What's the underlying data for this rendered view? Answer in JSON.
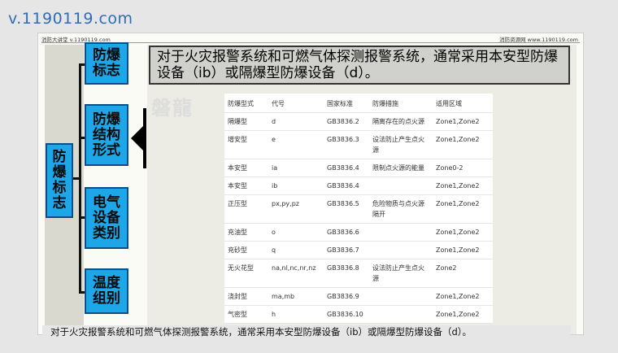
{
  "watermark": "v.1190119.com",
  "slide_header": {
    "left": "消防大讲堂 v.1190119.com",
    "right": "消防资源网 www.1190119.com"
  },
  "root_box": "防爆标志",
  "branches": [
    "防爆标志",
    "防爆结构形式",
    "电气设备类别",
    "温度组别"
  ],
  "callout": "对于火灾报警系统和可燃气体探测报警系统，通常采用本安型防爆设备（ib）或隔爆型防爆设备（d）。",
  "faint_logo": "磐龍",
  "table": {
    "headers": [
      "防爆型式",
      "代号",
      "国家标准",
      "防爆措施",
      "适用区域"
    ],
    "rows": [
      [
        "隔爆型",
        "d",
        "GB3836.2",
        "隔离存在的点火源",
        "Zone1,Zone2"
      ],
      [
        "增安型",
        "e",
        "GB3836.3",
        "设法防止产生点火源",
        "Zone1,Zone2"
      ],
      [
        "本安型",
        "ia",
        "GB3836.4",
        "限制点火源的能量",
        "Zone0-2"
      ],
      [
        "本安型",
        "ib",
        "GB3836.4",
        "",
        "Zone1,Zone2"
      ],
      [
        "正压型",
        "px,py,pz",
        "GB3836.5",
        "危险物质与点火源隔开",
        "Zone1,Zone2"
      ],
      [
        "充油型",
        "o",
        "GB3836.6",
        "",
        "Zone1,Zone2"
      ],
      [
        "充砂型",
        "q",
        "GB3836.7",
        "",
        "Zone1,Zone2"
      ],
      [
        "无火花型",
        "na,nl,nc,nr,nz",
        "GB3836.8",
        "设法防止产生点火源",
        "Zone2"
      ],
      [
        "浇封型",
        "ma,mb",
        "GB3836.9",
        "",
        "Zone1,Zone2"
      ],
      [
        "气密型",
        "h",
        "GB3836.10",
        "",
        "Zone1,Zone2"
      ]
    ]
  },
  "caption": "对于火灾报警系统和可燃气体探测报警系统，通常采用本安型防爆设备（ib）或隔爆型防爆设备（d）。",
  "colors": {
    "box_fill": "#1ea7e8",
    "box_border": "#0b4f8a",
    "watermark": "#2f6db5"
  }
}
